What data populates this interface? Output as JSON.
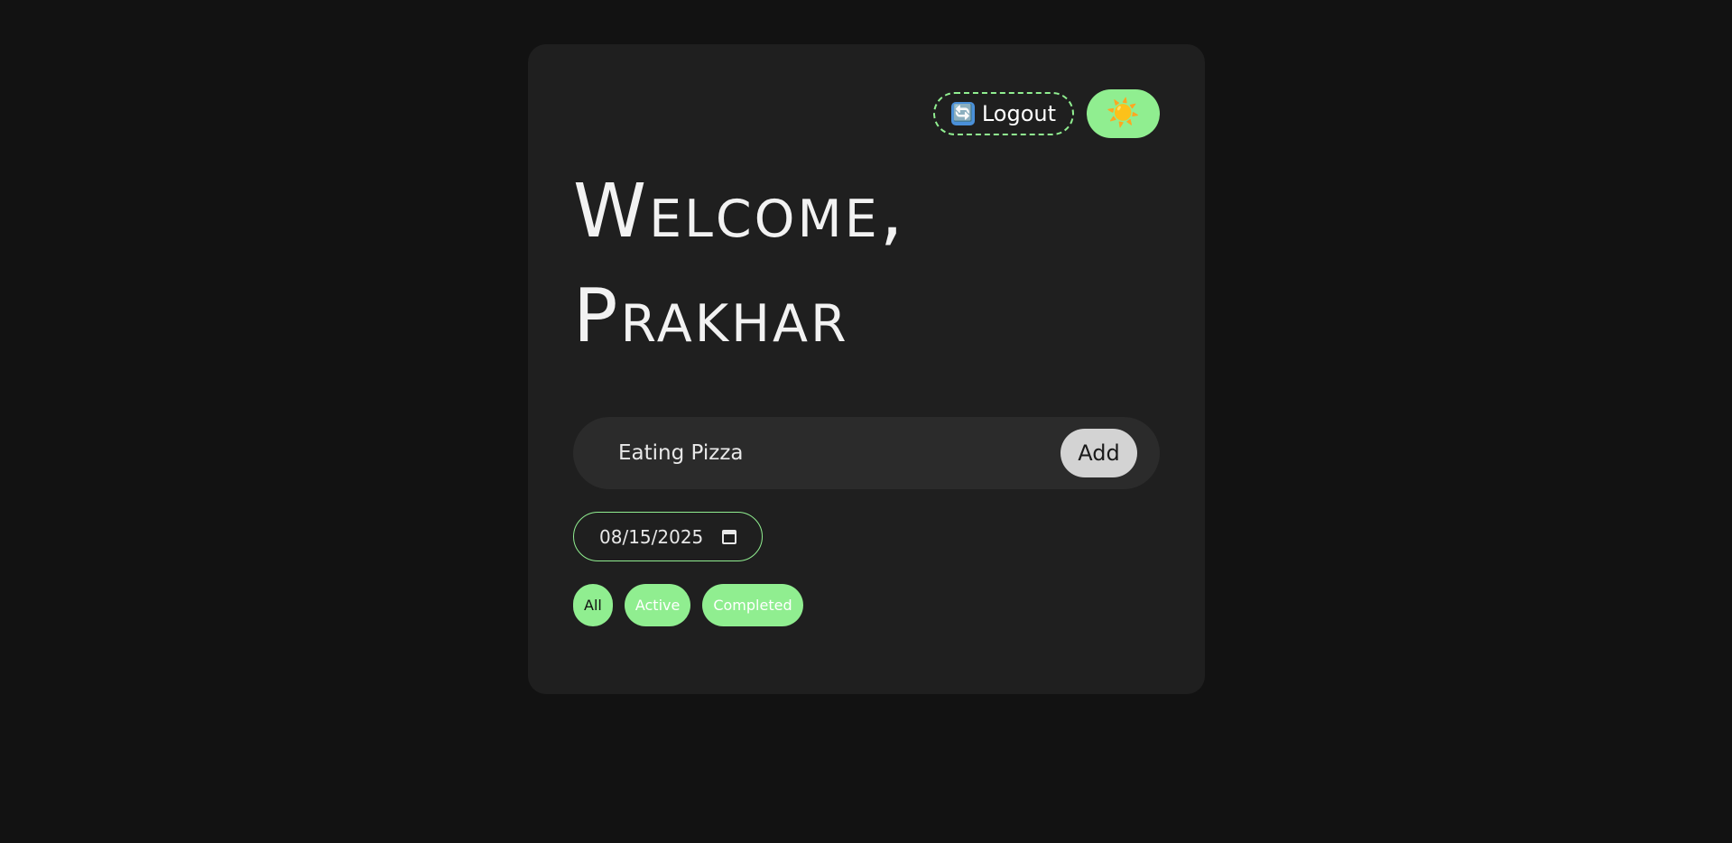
{
  "header": {
    "logout_icon": "🔄",
    "logout_label": "Logout",
    "theme_icon": "☀️"
  },
  "welcome": {
    "line1": "Welcome,",
    "line2": "Prakhar"
  },
  "task_form": {
    "input_value": "Eating Pizza",
    "add_label": "Add"
  },
  "due_date": {
    "value": "08/15/2025"
  },
  "filters": {
    "selected": "All",
    "items": [
      "All",
      "Active",
      "Completed"
    ]
  },
  "colors": {
    "page_background": "#121212",
    "card_background": "#1f1f1f",
    "accent": "#90ee90",
    "add_button": "#d3d3d3"
  }
}
